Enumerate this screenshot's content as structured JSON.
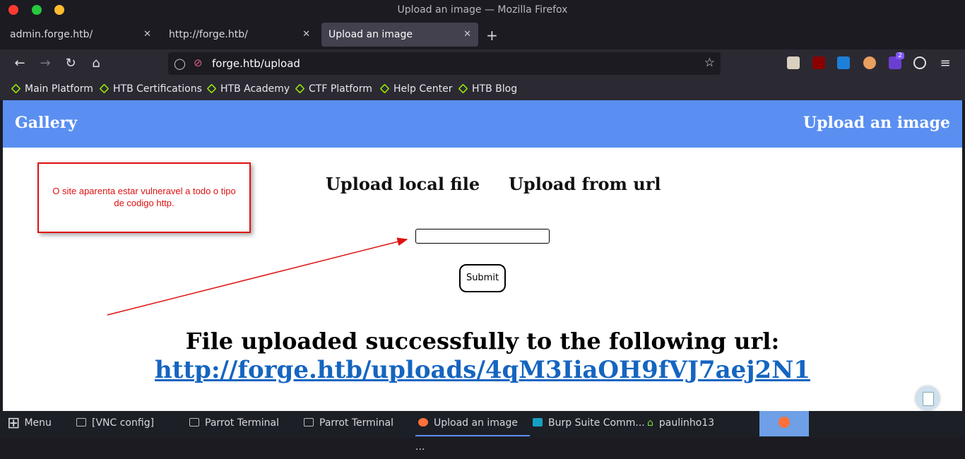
{
  "window": {
    "title": "Upload an image — Mozilla Firefox"
  },
  "tabs": [
    {
      "label": "admin.forge.htb/"
    },
    {
      "label": "http://forge.htb/"
    },
    {
      "label": "Upload an image"
    }
  ],
  "url": "forge.htb/upload",
  "bookmarks": [
    "Main Platform",
    "HTB Certifications",
    "HTB Academy",
    "CTF Platform",
    "Help Center",
    "HTB Blog"
  ],
  "page": {
    "brand": "Gallery",
    "header_right": "Upload an image",
    "choice_local": "Upload local file",
    "choice_url": "Upload from url",
    "submit_label": "Submit",
    "success_text": "File uploaded successfully to the following url:",
    "upload_url": "http://forge.htb/uploads/4qM3IiaOH9fVJ7aej2N1"
  },
  "annotation": {
    "text": "O site aparenta estar vulneravel a todo o tipo de codigo http."
  },
  "taskbar": {
    "menu": "Menu",
    "items": [
      "[VNC config]",
      "Parrot Terminal",
      "Parrot Terminal",
      "Upload an image ...",
      "Burp Suite Comm...",
      "paulinho13"
    ]
  },
  "ext_badge": "2",
  "colors": {
    "header": "#5a8ff1",
    "link": "#1565c0",
    "annotation": "#e01010",
    "htb_green": "#9fef00"
  }
}
